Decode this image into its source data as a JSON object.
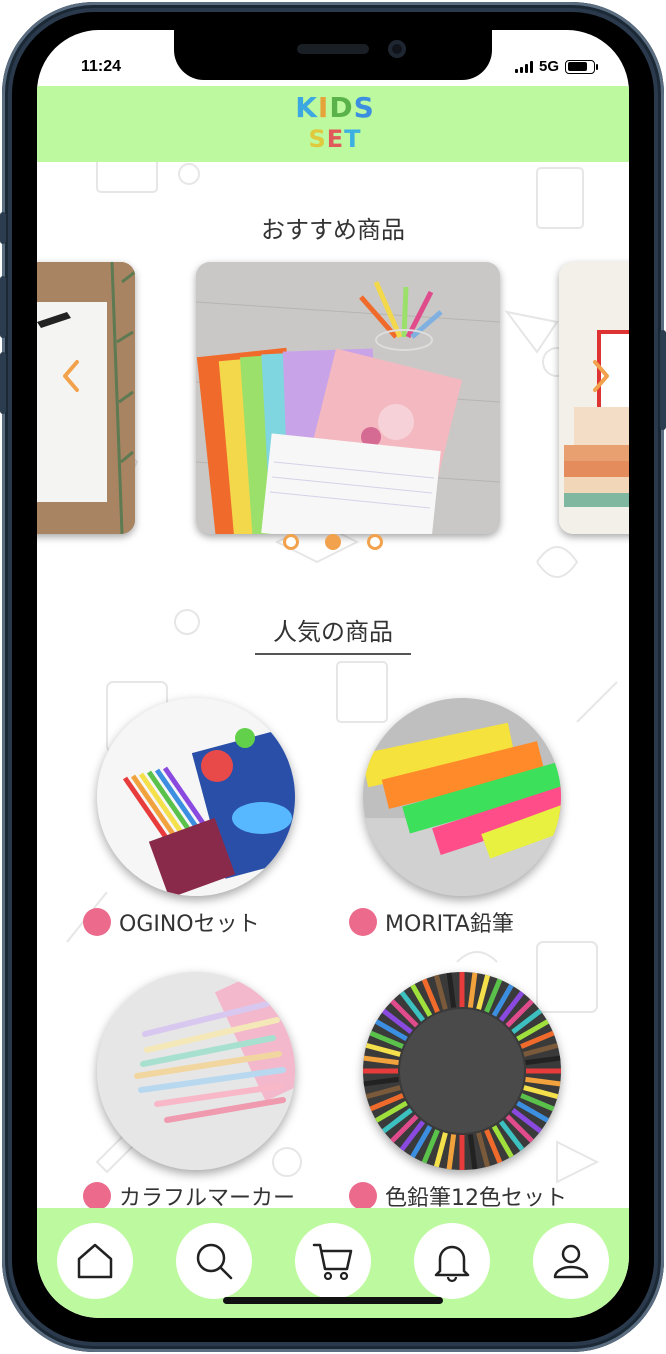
{
  "status_bar": {
    "time": "11:24",
    "network": "5G",
    "battery_level": 0.9
  },
  "header": {
    "logo_line1": [
      "K",
      "I",
      "D",
      "S"
    ],
    "logo_line2": [
      "S",
      "E",
      "T"
    ],
    "logo_colors1": [
      "#3ca7e0",
      "#e6a33a",
      "#5ab34a",
      "#3c8fe0"
    ],
    "logo_colors2": [
      "#e0c93c",
      "#e05a5a",
      "#3cb0e0"
    ]
  },
  "recommended": {
    "title": "おすすめ商品",
    "slides": [
      "stationery-left",
      "notebooks-center",
      "books-right"
    ],
    "active_index": 1,
    "dot_count": 3
  },
  "popular": {
    "title": "人気の商品",
    "items": [
      {
        "name": "OGINOセット",
        "image": "kids-set"
      },
      {
        "name": "MORITA鉛筆",
        "image": "highlighters"
      },
      {
        "name": "カラフルマーカー",
        "image": "pastel-pencils"
      },
      {
        "name": "色鉛筆12色セット",
        "image": "color-pencil-circle"
      }
    ]
  },
  "tabbar": {
    "items": [
      "home-icon",
      "search-icon",
      "cart-icon",
      "bell-icon",
      "user-icon"
    ]
  },
  "colors": {
    "header_green": "#bdf99e",
    "accent_orange": "#f2a24c",
    "bullet_pink": "#ec6a8b"
  }
}
